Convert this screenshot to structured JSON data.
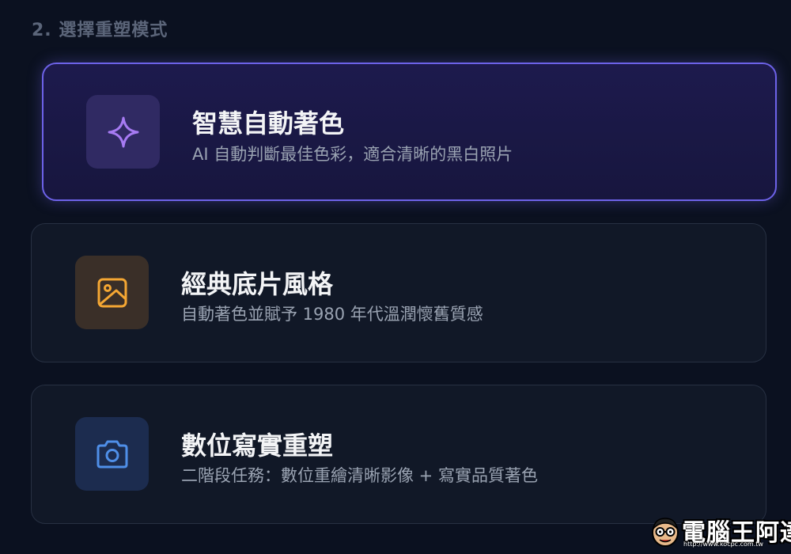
{
  "section": {
    "title": "2. 選擇重塑模式"
  },
  "modes": [
    {
      "title": "智慧自動著色",
      "description": "AI 自動判斷最佳色彩，適合清晰的黑白照片",
      "icon": "sparkle-icon",
      "selected": true,
      "accent": "#a77bf3"
    },
    {
      "title": "經典底片風格",
      "description": "自動著色並賦予 1980 年代溫潤懷舊質感",
      "icon": "image-icon",
      "selected": false,
      "accent": "#f5a733"
    },
    {
      "title": "數位寫實重塑",
      "description": "二階段任務：數位重繪清晰影像 + 寫實品質著色",
      "icon": "camera-icon",
      "selected": false,
      "accent": "#4f8fe8"
    }
  ],
  "watermark": {
    "name": "電腦王阿達",
    "url": "http://www.kocpc.com.tw"
  },
  "colors": {
    "background": "#0b1120",
    "selected_border": "#6d62e8",
    "card_border": "#273042"
  }
}
